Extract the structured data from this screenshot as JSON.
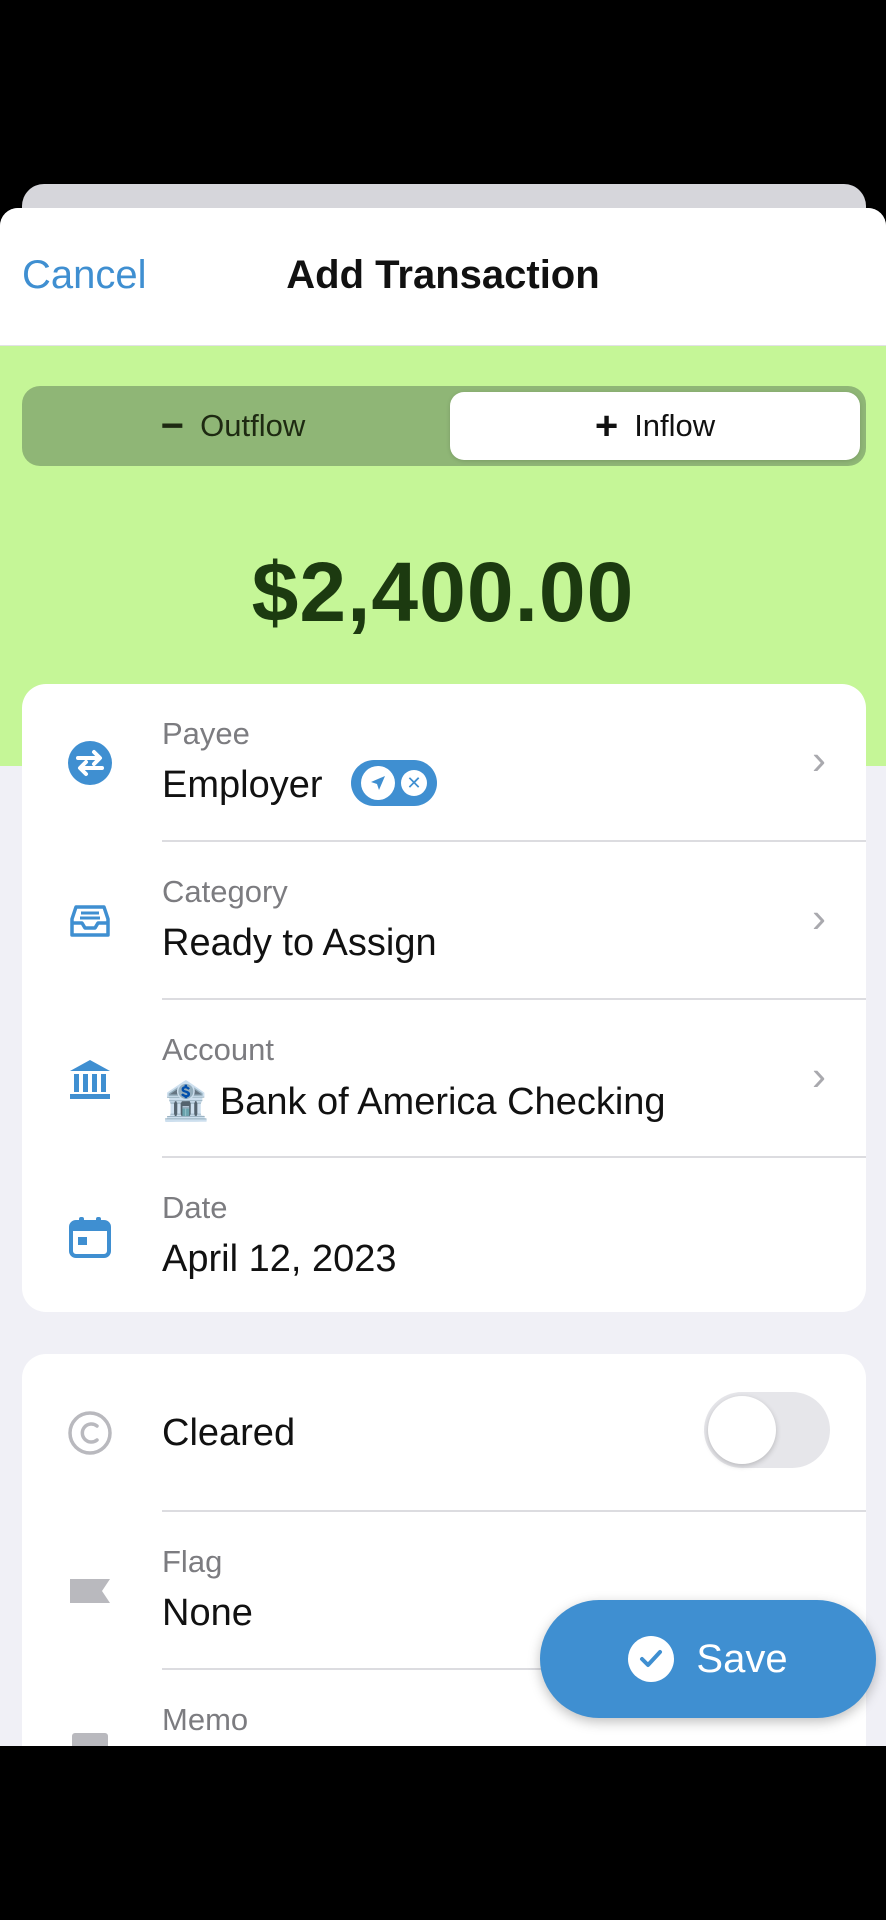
{
  "nav": {
    "cancel_label": "Cancel",
    "title": "Add Transaction"
  },
  "direction": {
    "outflow_label": "Outflow",
    "outflow_glyph": "−",
    "inflow_label": "Inflow",
    "inflow_glyph": "+",
    "selected": "Inflow"
  },
  "amount": "$2,400.00",
  "details": {
    "payee": {
      "label": "Payee",
      "value": "Employer",
      "icon": "transfer-arrows-icon",
      "pill_icon": "location-arrow-icon"
    },
    "category": {
      "label": "Category",
      "value": "Ready to Assign",
      "icon": "inbox-tray-icon"
    },
    "account": {
      "label": "Account",
      "value": "🏦 Bank of America Checking",
      "icon": "bank-icon"
    },
    "date": {
      "label": "Date",
      "value": "April 12, 2023",
      "icon": "calendar-icon"
    }
  },
  "extras": {
    "cleared": {
      "label": "Cleared",
      "on": false,
      "icon": "cleared-circle-icon"
    },
    "flag": {
      "label": "Flag",
      "value": "None",
      "icon": "flag-icon"
    },
    "memo": {
      "label": "Memo",
      "icon": "memo-icon"
    }
  },
  "save_label": "Save",
  "colors": {
    "accent": "#3f8fd1",
    "inflow_green": "#c5f697",
    "amount_text": "#1c3a10"
  }
}
